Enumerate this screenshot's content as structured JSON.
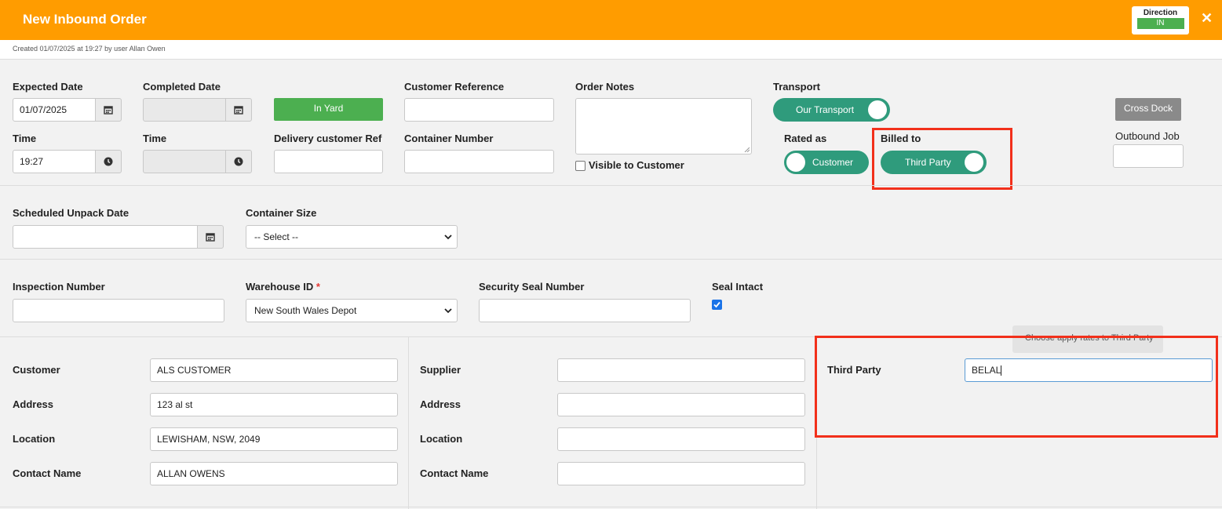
{
  "header": {
    "title": "New Inbound Order",
    "direction_label": "Direction",
    "direction_value": "IN",
    "close_glyph": "✕"
  },
  "meta": {
    "created_text": "Created 01/07/2025 at 19:27 by user Allan Owen"
  },
  "colors": {
    "header": "#ff9c00",
    "green_button": "#4caf50",
    "toggle": "#2f9b7c",
    "highlight": "#f2301b",
    "grey_button": "#8a8a8a"
  },
  "form": {
    "expected_date": {
      "label": "Expected Date",
      "value": "01/07/2025"
    },
    "completed_date": {
      "label": "Completed Date",
      "value": ""
    },
    "in_yard_button": "In Yard",
    "customer_reference": {
      "label": "Customer Reference",
      "value": ""
    },
    "order_notes": {
      "label": "Order Notes",
      "value": ""
    },
    "visible_to_customer": {
      "label": "Visible to Customer",
      "checked": false
    },
    "transport": {
      "label": "Transport",
      "toggle_text": "Our Transport"
    },
    "cross_dock_button": "Cross Dock",
    "expected_time": {
      "label": "Time",
      "value": "19:27"
    },
    "completed_time": {
      "label": "Time",
      "value": ""
    },
    "delivery_customer_ref": {
      "label": "Delivery customer Ref",
      "value": ""
    },
    "container_number": {
      "label": "Container Number",
      "value": ""
    },
    "rated_as": {
      "label": "Rated as",
      "toggle_text": "Customer"
    },
    "billed_to": {
      "label": "Billed to",
      "toggle_text": "Third Party"
    },
    "outbound_job": {
      "label": "Outbound Job",
      "value": ""
    },
    "scheduled_unpack_date": {
      "label": "Scheduled Unpack Date",
      "value": ""
    },
    "container_size": {
      "label": "Container Size",
      "value": "-- Select --"
    },
    "inspection_number": {
      "label": "Inspection Number",
      "value": ""
    },
    "warehouse_id": {
      "label": "Warehouse ID",
      "required_mark": "*",
      "value": "New South Wales Depot"
    },
    "security_seal_number": {
      "label": "Security Seal Number",
      "value": ""
    },
    "seal_intact": {
      "label": "Seal Intact",
      "checked": true
    }
  },
  "customer": {
    "customer_label": "Customer",
    "customer_value": "ALS CUSTOMER",
    "address_label": "Address",
    "address_value": "123 al st",
    "location_label": "Location",
    "location_value": "LEWISHAM, NSW, 2049",
    "contact_label": "Contact Name",
    "contact_value": "ALLAN OWENS"
  },
  "supplier": {
    "supplier_label": "Supplier",
    "supplier_value": "",
    "address_label": "Address",
    "address_value": "",
    "location_label": "Location",
    "location_value": "",
    "contact_label": "Contact Name",
    "contact_value": ""
  },
  "third_party": {
    "label": "Third Party",
    "value": "BELAL",
    "tooltip": "Choose apply rates to Third Party"
  }
}
